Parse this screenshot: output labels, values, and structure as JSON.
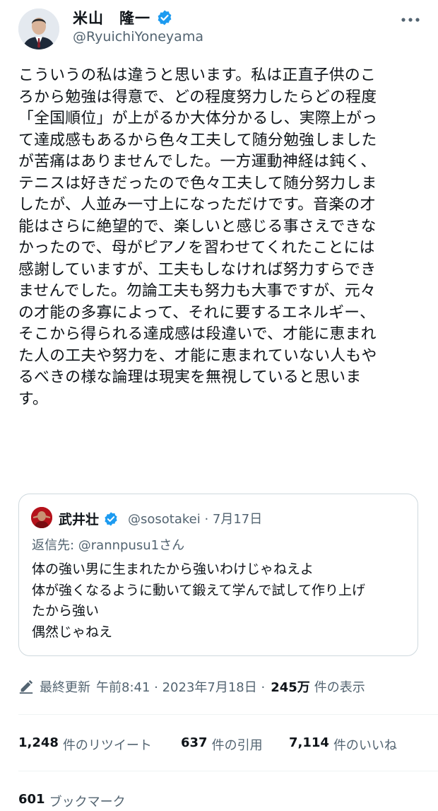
{
  "author": {
    "display_name": "米山　隆一",
    "handle": "@RyuichiYoneyama"
  },
  "tweet": {
    "lines": [
      "こういうの私は違うと思います。私は正直子供のこ",
      "ろから勉強は得意で、どの程度努力したらどの程度",
      "「全国順位」が上がるか大体分かるし、実際上がっ",
      "て達成感もあるから色々工夫して随分勉強しました",
      "が苦痛はありませんでした。一方運動神経は鈍く、",
      "テニスは好きだったので色々工夫して随分努力しま",
      "したが、人並み一寸上になっただけです。音楽の才",
      "能はさらに絶望的で、楽しいと感じる事さえできな",
      "かったので、母がピアノを習わせてくれたことには",
      "感謝していますが、工夫もしなければ努力すらでき",
      "ませんでした。勿論工夫も努力も大事ですが、元々",
      "の才能の多寡によって、それに要するエネルギー、",
      "そこから得られる達成感は段違いで、才能に恵まれ",
      "た人の工夫や努力を、才能に恵まれていない人もや",
      "るべきの様な論理は現実を無視していると思いま",
      "す。"
    ]
  },
  "quote": {
    "display_name": "武井壮",
    "handle_date": "@sosotakei · 7月17日",
    "reply_to": "返信先: @rannpusu1さん",
    "lines": [
      "体の強い男に生まれたから強いわけじゃねえよ",
      "体が強くなるように動いて鍛えて学んで試して作り上げ",
      "たから強い",
      "偶然じゃねえ"
    ]
  },
  "meta": {
    "edited_label": "最終更新",
    "time_date": "午前8:41 · 2023年7月18日 ·",
    "views_count": "245万",
    "views_label": "件の表示"
  },
  "stats": {
    "retweets_count": "1,248",
    "retweets_label": "件のリツイート",
    "quotes_count": "637",
    "quotes_label": "件の引用",
    "likes_count": "7,114",
    "likes_label": "件のいいね",
    "bookmarks_count": "601",
    "bookmarks_label": "ブックマーク"
  },
  "colors": {
    "verified_blue": "#1d9bf0",
    "secondary_text": "#536471",
    "primary_text": "#0f1419"
  }
}
